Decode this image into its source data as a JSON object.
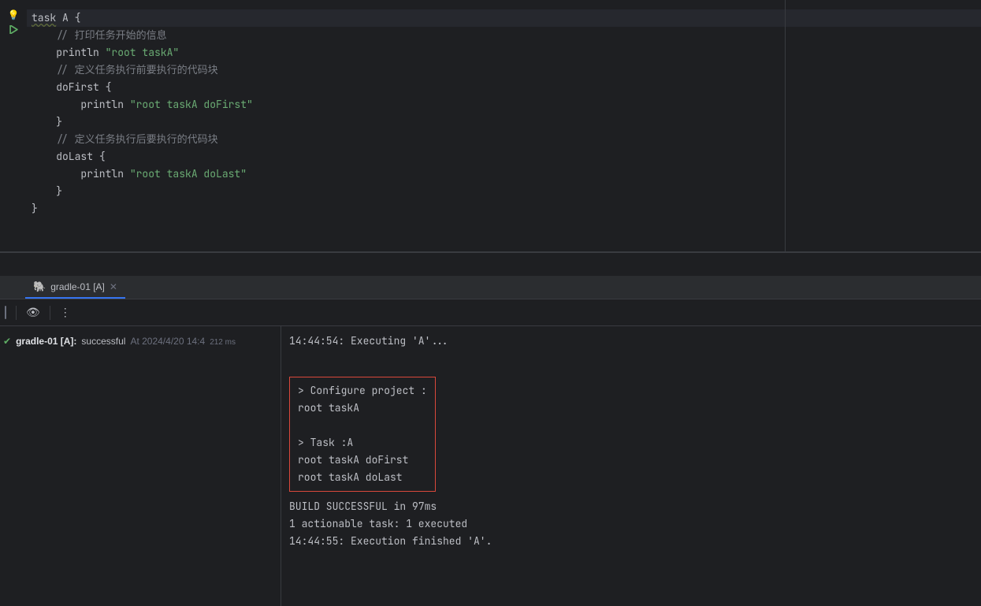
{
  "editor": {
    "code": {
      "task_kw": "task",
      "task_name": " A ",
      "brace_open": "{",
      "comment1": "// 打印任务开始的信息",
      "println": "println ",
      "str1": "\"root taskA\"",
      "comment2": "// 定义任务执行前要执行的代码块",
      "dofirst": "doFirst ",
      "str2": "\"root taskA doFirst\"",
      "brace_close1": "}",
      "comment3": "// 定义任务执行后要执行的代码块",
      "dolast": "doLast ",
      "str3": "\"root taskA doLast\"",
      "brace_close2": "}",
      "brace_close3": "}"
    }
  },
  "run": {
    "tab_label": "gradle-01 [A]",
    "status": {
      "name": "gradle-01 [A]:",
      "result": "successful",
      "at": "At 2024/4/20 14:4",
      "duration": "212 ms"
    },
    "console": {
      "line1": "14:44:54: Executing 'A'...",
      "box_l1": "> Configure project :",
      "box_l2": "root taskA",
      "box_l3": "> Task :A",
      "box_l4": "root taskA doFirst",
      "box_l5": "root taskA doLast",
      "line2": "BUILD SUCCESSFUL in 97ms",
      "line3": "1 actionable task: 1 executed",
      "line4": "14:44:55: Execution finished 'A'."
    }
  }
}
